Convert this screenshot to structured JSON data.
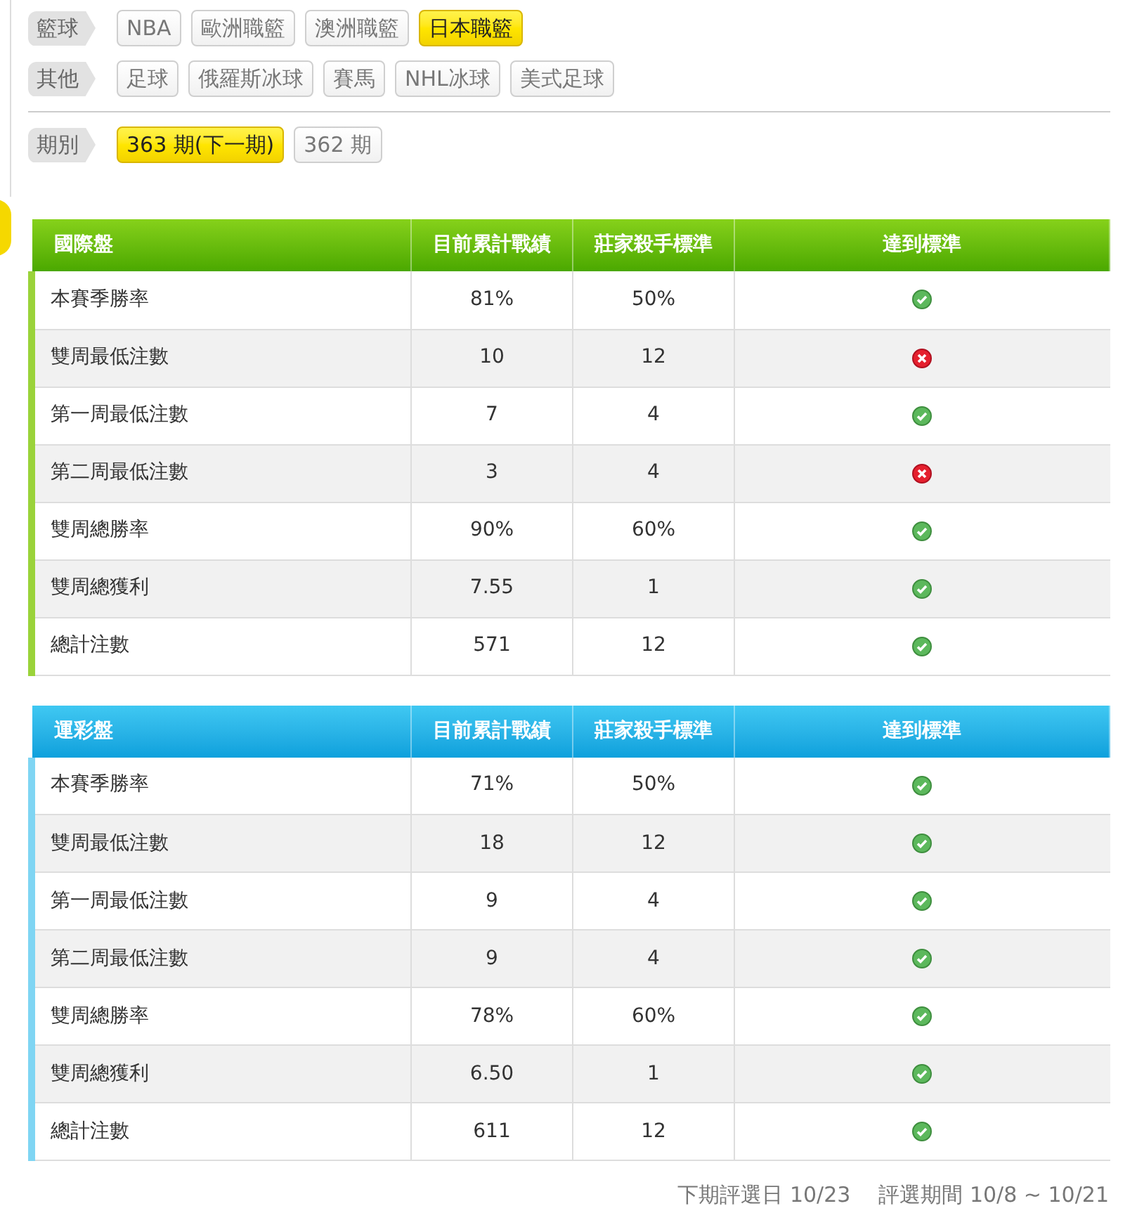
{
  "filters": [
    {
      "label": "籃球",
      "options": [
        {
          "text": "NBA",
          "selected": false
        },
        {
          "text": "歐洲職籃",
          "selected": false
        },
        {
          "text": "澳洲職籃",
          "selected": false
        },
        {
          "text": "日本職籃",
          "selected": true
        }
      ]
    },
    {
      "label": "其他",
      "options": [
        {
          "text": "足球",
          "selected": false
        },
        {
          "text": "俄羅斯冰球",
          "selected": false
        },
        {
          "text": "賽馬",
          "selected": false
        },
        {
          "text": "NHL冰球",
          "selected": false
        },
        {
          "text": "美式足球",
          "selected": false
        }
      ]
    }
  ],
  "period": {
    "label": "期別",
    "options": [
      {
        "text": "363 期(下一期)",
        "selected": true
      },
      {
        "text": "362 期",
        "selected": false
      }
    ]
  },
  "tables": [
    {
      "kind": "green",
      "columns": [
        "國際盤",
        "目前累計戰績",
        "莊家殺手標準",
        "達到標準"
      ],
      "rows": [
        {
          "name": "本賽季勝率",
          "current": "81%",
          "standard": "50%",
          "met": true
        },
        {
          "name": "雙周最低注數",
          "current": "10",
          "standard": "12",
          "met": false
        },
        {
          "name": "第一周最低注數",
          "current": "7",
          "standard": "4",
          "met": true
        },
        {
          "name": "第二周最低注數",
          "current": "3",
          "standard": "4",
          "met": false
        },
        {
          "name": "雙周總勝率",
          "current": "90%",
          "standard": "60%",
          "met": true
        },
        {
          "name": "雙周總獲利",
          "current": "7.55",
          "standard": "1",
          "met": true
        },
        {
          "name": "總計注數",
          "current": "571",
          "standard": "12",
          "met": true
        }
      ]
    },
    {
      "kind": "blue",
      "columns": [
        "運彩盤",
        "目前累計戰績",
        "莊家殺手標準",
        "達到標準"
      ],
      "rows": [
        {
          "name": "本賽季勝率",
          "current": "71%",
          "standard": "50%",
          "met": true
        },
        {
          "name": "雙周最低注數",
          "current": "18",
          "standard": "12",
          "met": true
        },
        {
          "name": "第一周最低注數",
          "current": "9",
          "standard": "4",
          "met": true
        },
        {
          "name": "第二周最低注數",
          "current": "9",
          "standard": "4",
          "met": true
        },
        {
          "name": "雙周總勝率",
          "current": "78%",
          "standard": "60%",
          "met": true
        },
        {
          "name": "雙周總獲利",
          "current": "6.50",
          "standard": "1",
          "met": true
        },
        {
          "name": "總計注數",
          "current": "611",
          "standard": "12",
          "met": true
        }
      ]
    }
  ],
  "footer": [
    "下期評選日 10/23",
    "評選期間 10/8 ~ 10/21"
  ]
}
